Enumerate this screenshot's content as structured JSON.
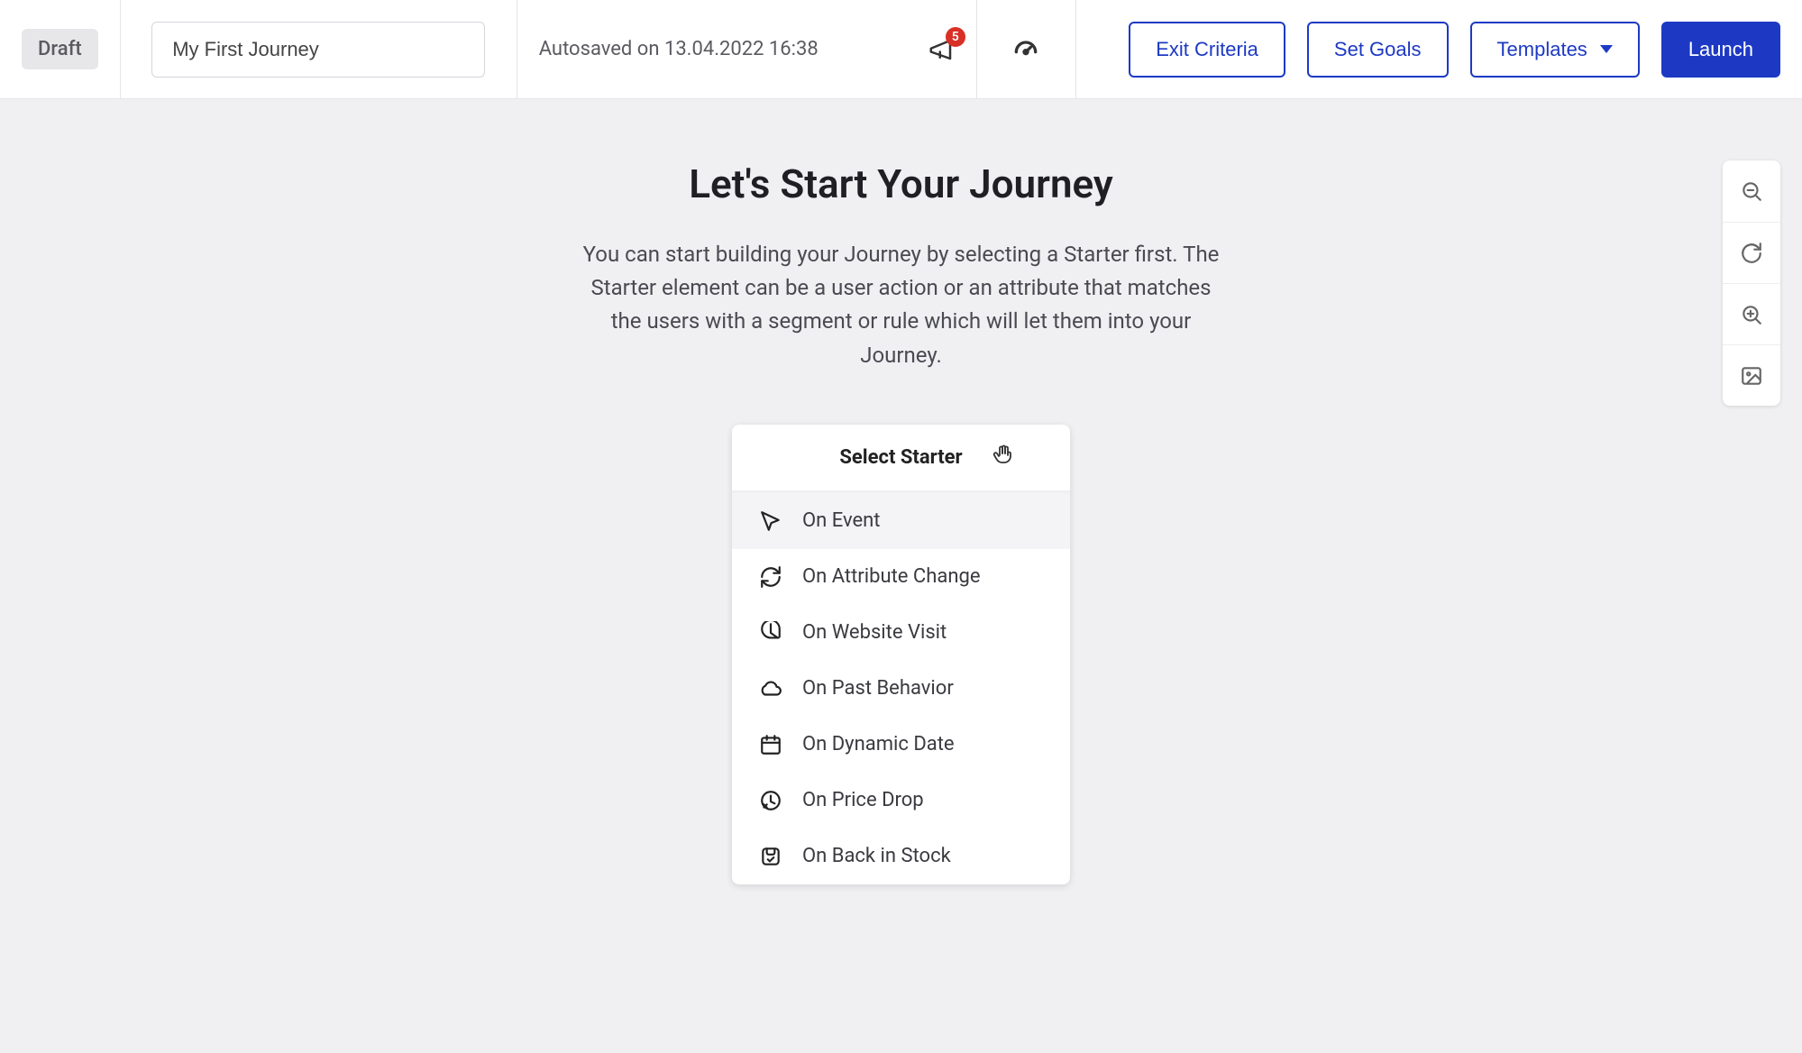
{
  "header": {
    "status_label": "Draft",
    "journey_name": "My First Journey",
    "autosave_text": "Autosaved on 13.04.2022 16:38",
    "notification_count": "5",
    "buttons": {
      "exit_criteria": "Exit Criteria",
      "set_goals": "Set Goals",
      "templates": "Templates",
      "launch": "Launch"
    }
  },
  "hero": {
    "title": "Let's Start Your Journey",
    "subtitle": "You can start building your Journey by selecting a Starter first. The Starter element can be a user action or an attribute that matches the users with a segment or rule which will let them into your Journey."
  },
  "starter": {
    "header": "Select Starter",
    "items": [
      {
        "label": "On Event",
        "icon": "cursor-icon"
      },
      {
        "label": "On Attribute Change",
        "icon": "refresh-icon"
      },
      {
        "label": "On Website Visit",
        "icon": "pie-icon"
      },
      {
        "label": "On Past Behavior",
        "icon": "cloud-icon"
      },
      {
        "label": "On Dynamic Date",
        "icon": "calendar-icon"
      },
      {
        "label": "On Price Drop",
        "icon": "price-drop-icon"
      },
      {
        "label": "On Back in Stock",
        "icon": "stock-icon"
      }
    ]
  }
}
